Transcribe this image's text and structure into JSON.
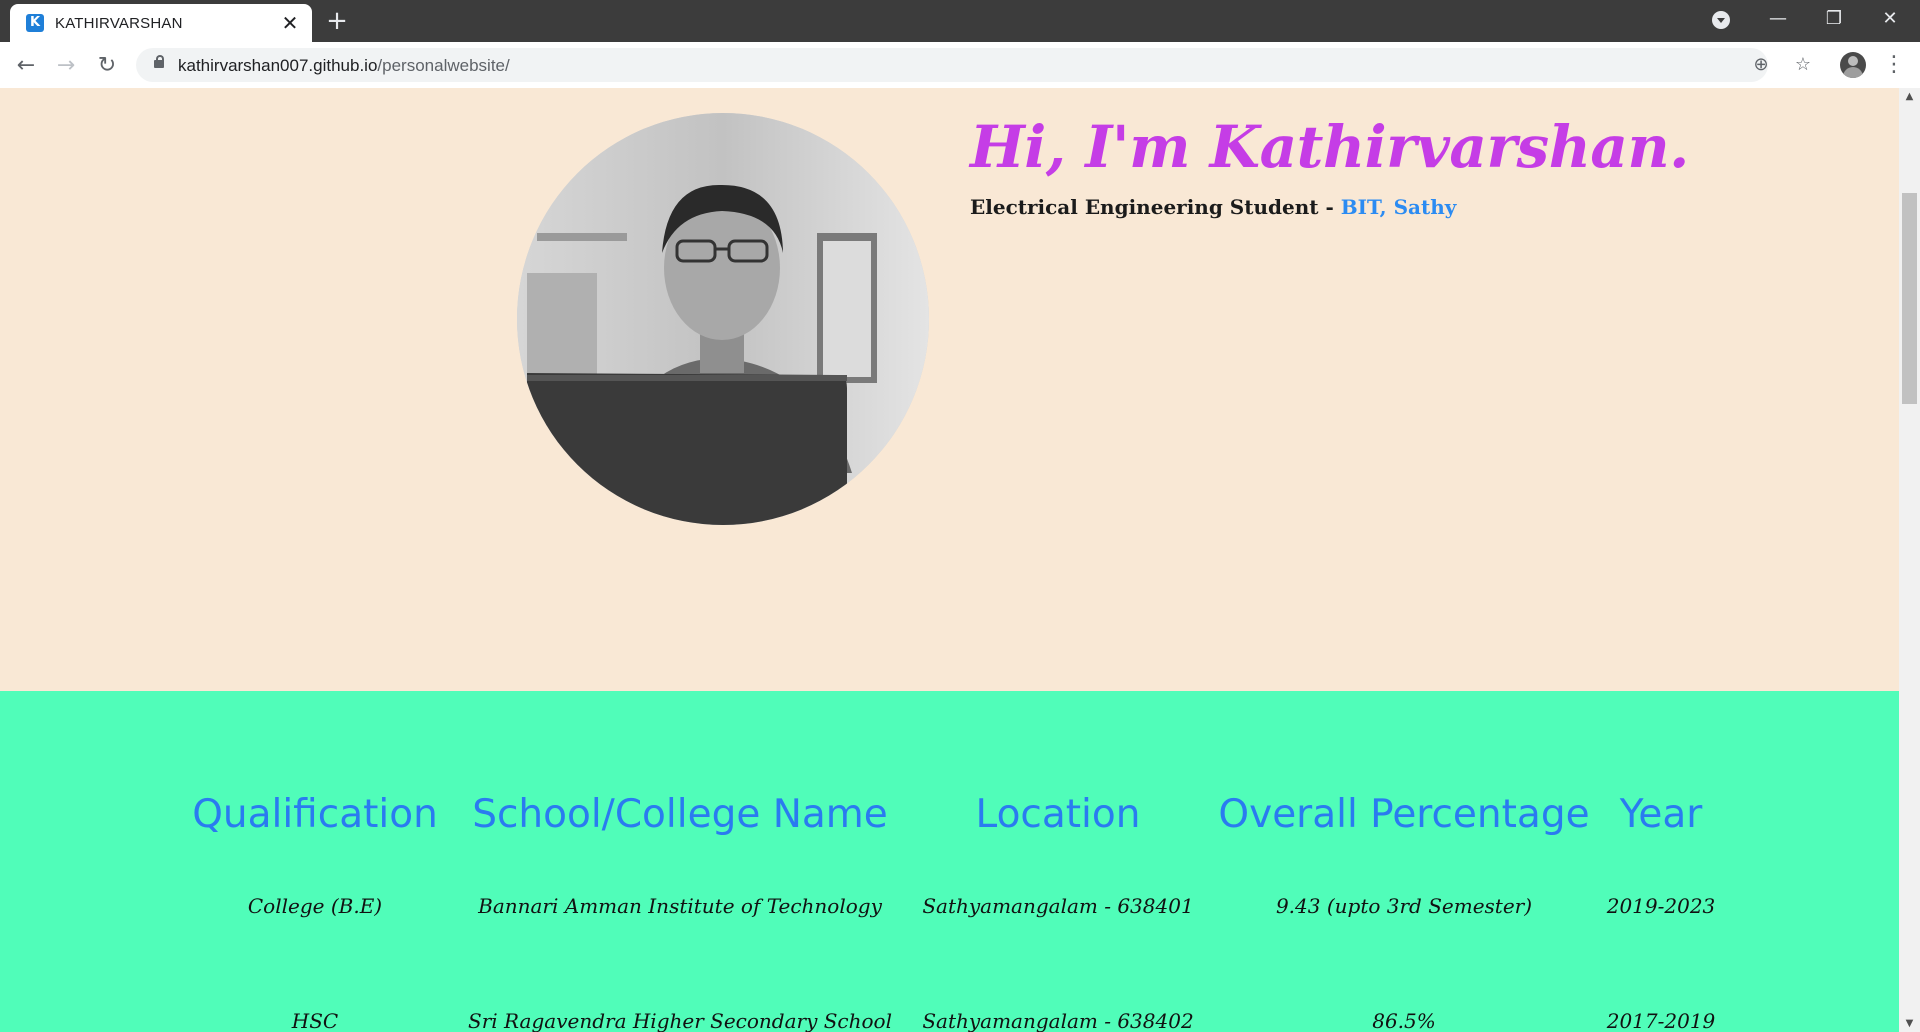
{
  "browser": {
    "tab_favicon_letter": "K",
    "tab_title": "KATHIRVARSHAN",
    "tab_close": "✕",
    "new_tab": "+",
    "url_domain": "kathirvarshan007.github.io",
    "url_path": "/personalwebsite/",
    "minimize": "—",
    "restore": "❐",
    "close": "✕",
    "back": "←",
    "forward": "→",
    "reload": "↻",
    "zoom_icon": "⊕",
    "star_icon": "☆",
    "menu": "⋮"
  },
  "hero": {
    "greeting": "Hi, I'm Kathirvarshan.",
    "subtitle_prefix": "Electrical Engineering Student - ",
    "subtitle_college": "BIT, Sathy"
  },
  "education": {
    "headers": [
      "Qualification",
      "School/College Name",
      "Location",
      "Overall Percentage",
      "Year"
    ],
    "rows": [
      [
        "College (B.E)",
        "Bannari Amman Institute of Technology",
        "Sathyamangalam - 638401",
        "9.43 (upto 3rd Semester)",
        "2019-2023"
      ],
      [
        "HSC",
        "Sri Ragavendra Higher Secondary School",
        "Sathyamangalam - 638402",
        "86.5%",
        "2017-2019"
      ]
    ]
  },
  "scrollbar": {
    "up": "▲",
    "down": "▼"
  }
}
